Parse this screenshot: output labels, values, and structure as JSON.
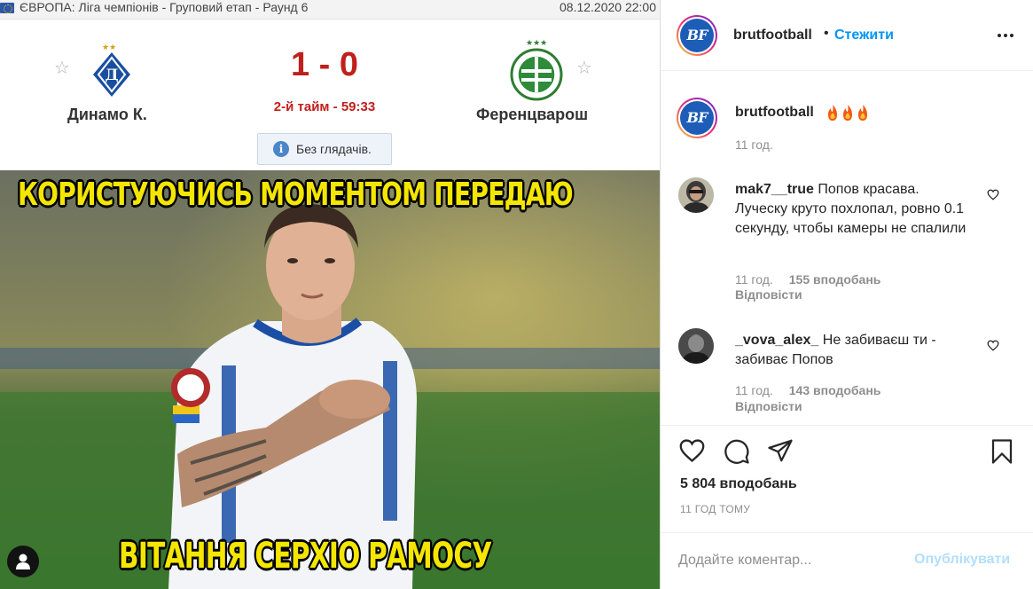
{
  "scoreboard": {
    "league": "ЄВРОПА: Ліга чемпіонів - Груповий етап - Раунд 6",
    "date": "08.12.2020 22:00",
    "home_team": "Динамо К.",
    "away_team": "Ференцварош",
    "score": "1 - 0",
    "match_time": "2-й тайм - 59:33",
    "notice": "Без глядачів.",
    "star_glyph": "☆"
  },
  "meme": {
    "top_text": "КОРИСТУЮЧИСЬ МОМЕНТОМ ПЕРЕДАЮ",
    "bottom_text": "ВІТАННЯ СЕРХІО РАМОСУ",
    "text_color": "#f4e600"
  },
  "post": {
    "username": "brutfootball",
    "avatar_text": "BF",
    "dot": "•",
    "follow_label": "Стежити",
    "caption_time": "11 год.",
    "caption_emoji": "fire-emoji x3",
    "likes": "5 804 вподобань",
    "date": "11 ГОД ТОМУ",
    "comment_placeholder": "Додайте коментар...",
    "publish_label": "Опублікувати"
  },
  "comments": [
    {
      "username": "mak7__true",
      "text": "Попов красава. Луческу круто похлопал, ровно 0.1 секунду, чтобы камеры не спалили",
      "time": "11 год.",
      "likes": "155 вподобань",
      "reply": "Відповісти"
    },
    {
      "username": "_vova_alex_",
      "text": "Не забиваєш ти - забиває Попов",
      "time": "11 год.",
      "likes": "143 вподобань",
      "reply": "Відповісти"
    }
  ],
  "colors": {
    "accent": "#0095f6",
    "publish_disabled": "#b2dffc",
    "score_red": "#c0201c",
    "secondary_text": "#8e8e8e"
  },
  "icons": [
    "more-icon",
    "heart-icon",
    "comment-icon",
    "share-icon",
    "bookmark-icon",
    "user-tag-icon",
    "info-icon",
    "star-icon"
  ]
}
